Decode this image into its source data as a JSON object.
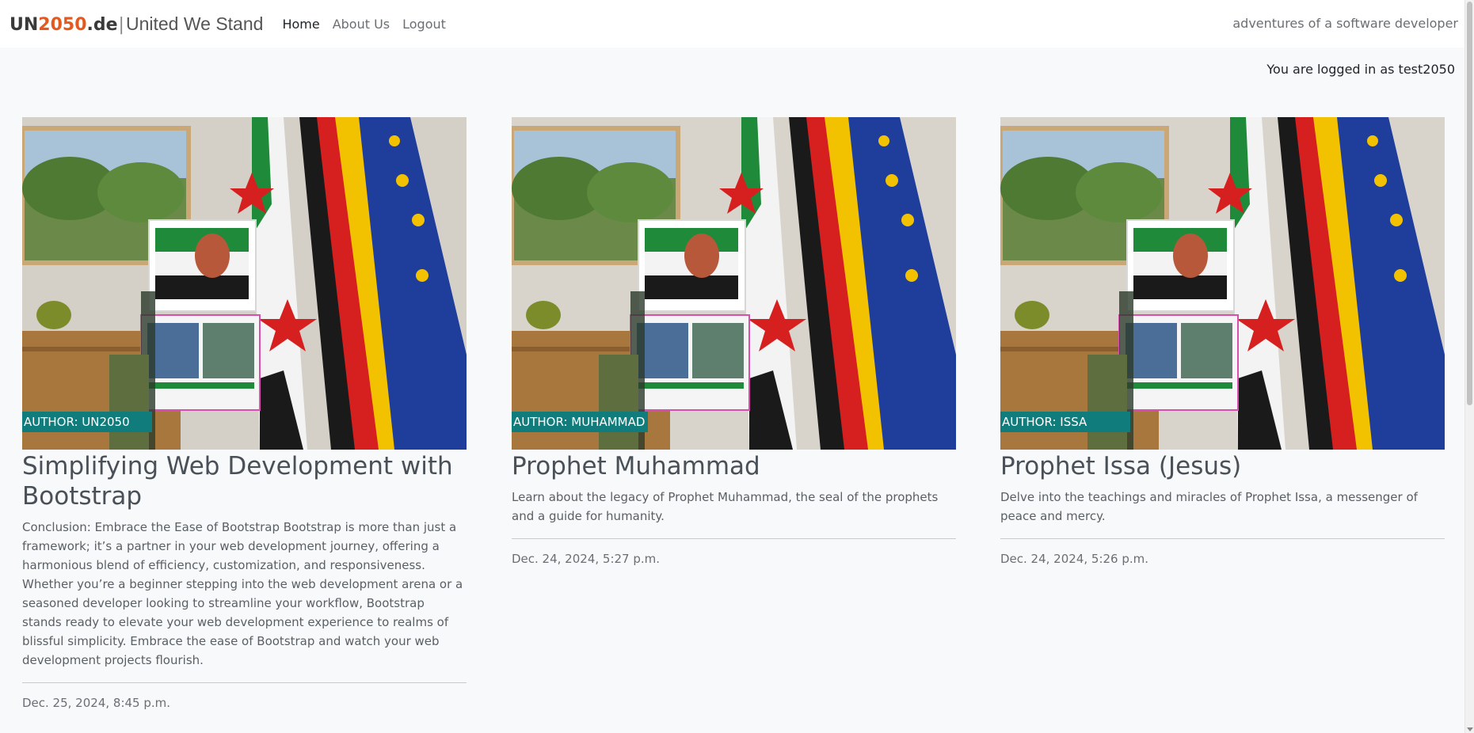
{
  "brand": {
    "un": "UN",
    "num": "2050",
    "dom": ".de",
    "sep": "|",
    "tagline": "United We Stand"
  },
  "nav": {
    "items": [
      {
        "label": "Home",
        "active": true
      },
      {
        "label": "About Us",
        "active": false
      },
      {
        "label": "Logout",
        "active": false
      }
    ],
    "right_text": "adventures of a software developer"
  },
  "status": {
    "logged_in": "You are logged in as test2050"
  },
  "posts": [
    {
      "author": "AUTHOR: UN2050",
      "title": "Simplifying Web Development with Bootstrap",
      "description": "Conclusion: Embrace the Ease of Bootstrap Bootstrap is more than just a framework; it’s a partner in your web development journey, offering a harmonious blend of efficiency, customization, and responsiveness. Whether you’re a beginner stepping into the web development arena or a seasoned developer looking to streamline your workflow, Bootstrap stands ready to elevate your web development experience to realms of blissful simplicity. Embrace the ease of Bootstrap and watch your web development projects flourish.",
      "date": "Dec. 25, 2024, 8:45 p.m."
    },
    {
      "author": "AUTHOR: MUHAMMAD",
      "title": "Prophet Muhammad",
      "description": "Learn about the legacy of Prophet Muhammad, the seal of the prophets and a guide for humanity.",
      "date": "Dec. 24, 2024, 5:27 p.m."
    },
    {
      "author": "AUTHOR: ISSA",
      "title": "Prophet Issa (Jesus)",
      "description": "Delve into the teachings and miracles of Prophet Issa, a messenger of peace and mercy.",
      "date": "Dec. 24, 2024, 5:26 p.m."
    }
  ],
  "colors": {
    "brand_orange": "#e25a20",
    "badge_teal": "#117c7c",
    "page_bg": "#f8f9fa"
  }
}
